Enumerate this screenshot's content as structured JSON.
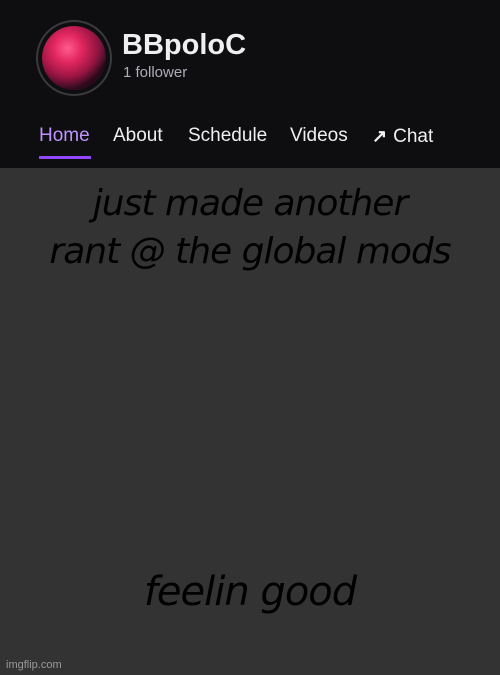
{
  "channel": {
    "name": "BBpoloC",
    "followers": "1 follower"
  },
  "nav": {
    "items": [
      {
        "label": "Home",
        "active": true
      },
      {
        "label": "About",
        "active": false
      },
      {
        "label": "Schedule",
        "active": false
      },
      {
        "label": "Videos",
        "active": false
      },
      {
        "label": "Chat",
        "active": false,
        "icon": "external-arrow-icon"
      }
    ]
  },
  "meme": {
    "top_text_line1": "just made another",
    "top_text_line2": "rant @ the global mods",
    "bottom_text": "feelin good"
  },
  "watermark": "imgflip.com",
  "colors": {
    "header_bg": "#0e0e10",
    "body_bg": "#333333",
    "accent": "#9147ff",
    "active_text": "#bf94ff"
  }
}
